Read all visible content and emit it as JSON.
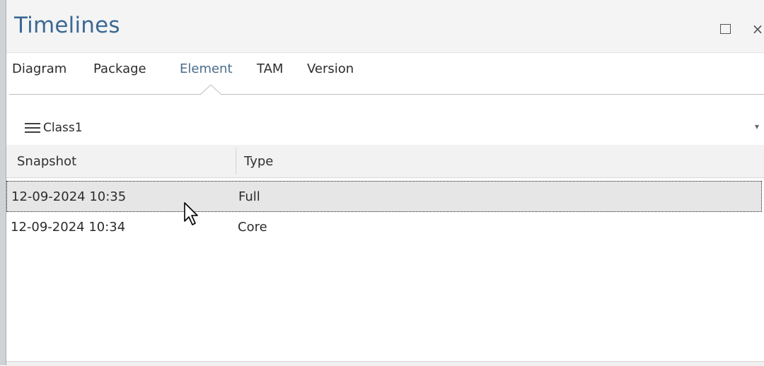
{
  "window": {
    "title": "Timelines",
    "maximize_icon": "maximize-icon",
    "close_glyph": "×"
  },
  "tabs": [
    {
      "label": "Diagram",
      "active": false
    },
    {
      "label": "Package",
      "active": false
    },
    {
      "label": "Element",
      "active": true
    },
    {
      "label": "TAM",
      "active": false
    },
    {
      "label": "Version",
      "active": false
    }
  ],
  "element_selector": {
    "icon": "hamburger-icon",
    "value": "Class1",
    "dropdown_glyph": "▾"
  },
  "table": {
    "columns": [
      "Snapshot",
      "Type"
    ],
    "rows": [
      {
        "snapshot": "12-09-2024 10:35",
        "type": "Full",
        "selected": true
      },
      {
        "snapshot": "12-09-2024 10:34",
        "type": "Core",
        "selected": false
      }
    ]
  },
  "colors": {
    "title": "#3b6994",
    "active_tab": "#4b6c8c",
    "selected_row": "#e6e6e6"
  }
}
